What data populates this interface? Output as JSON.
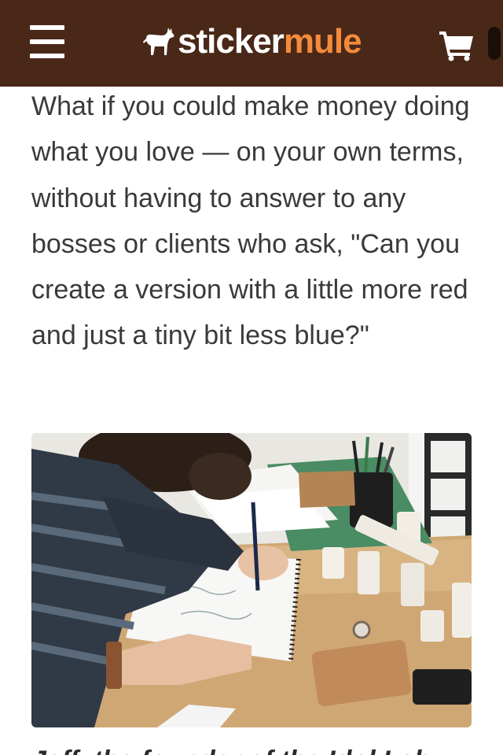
{
  "header": {
    "menu_icon": "hamburger-menu-icon",
    "logo": {
      "icon": "mule-icon",
      "word_sticker": "sticker",
      "word_mule": "mule",
      "colors": {
        "sticker": "#ffffff",
        "mule": "#f48a3c"
      }
    },
    "cart_icon": "shopping-cart-icon",
    "background_color": "#4a2818"
  },
  "article": {
    "intro_text": "What if you could make money doing what you love — on your own terms, without having to answer to any bosses or clients who ask, \"Can you create a version with a little more red and just a tiny bit less blue?\"",
    "text_color": "#3a3a3a",
    "photo": {
      "subject": "person sketching in a spiral notebook at a wooden desk with wooden block figures, a leather wallet and a pen holder"
    },
    "caption_partial": "Jeff, the founder of the Idol Lab"
  }
}
